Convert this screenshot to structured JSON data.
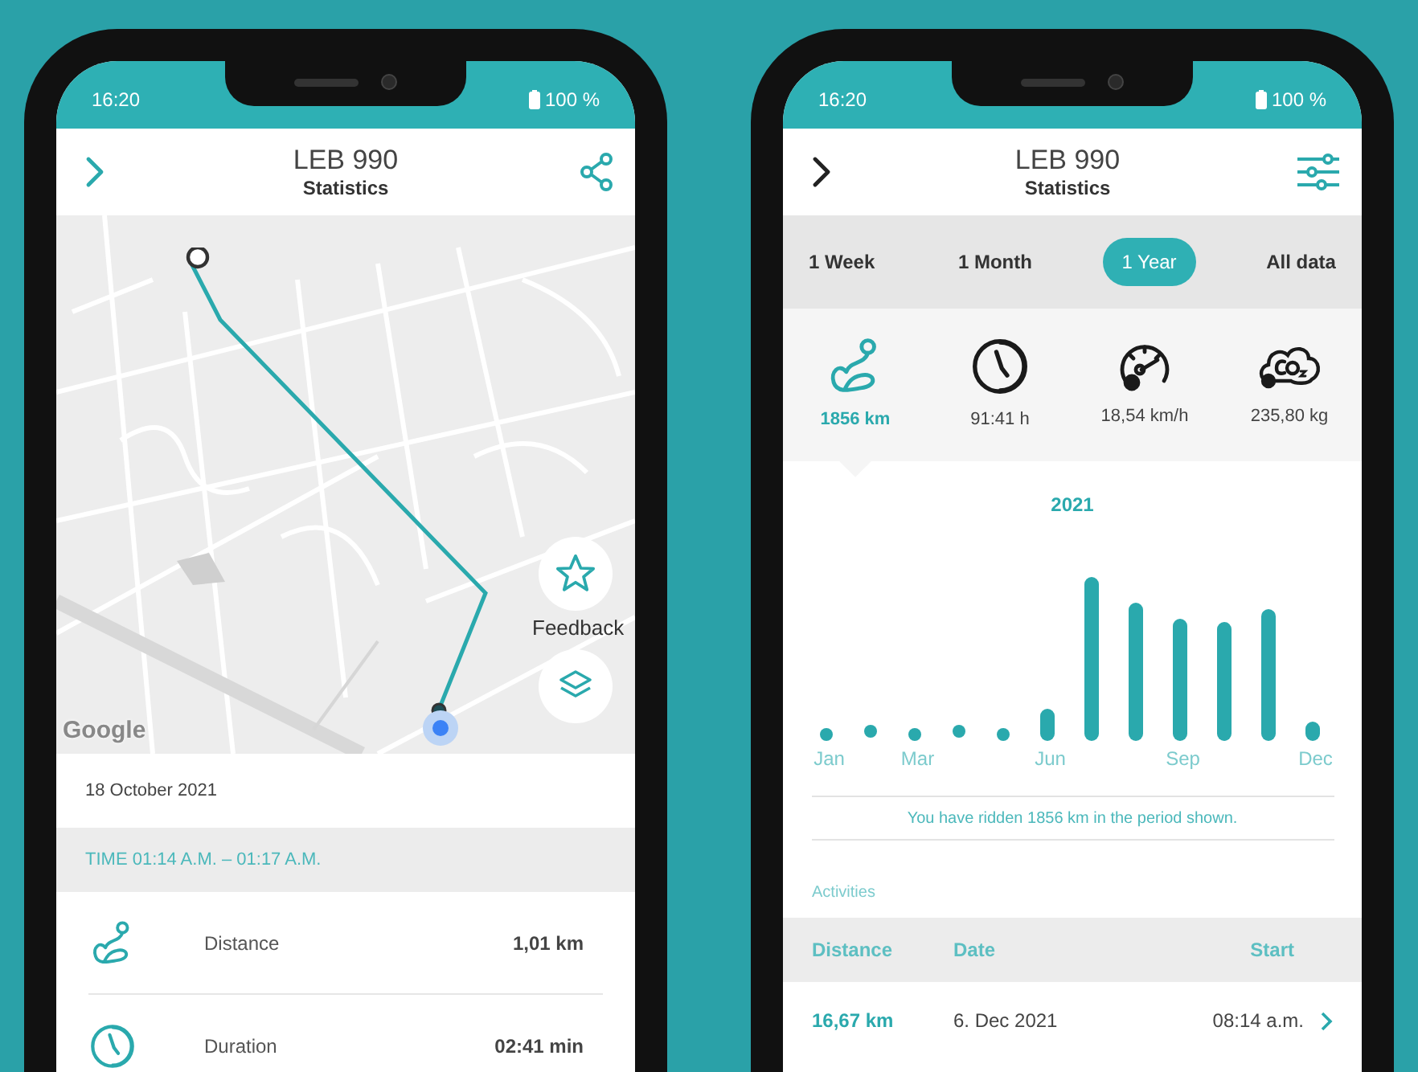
{
  "left_phone": {
    "status_bar": {
      "time": "16:20",
      "battery": "100 %"
    },
    "header": {
      "title": "LEB 990",
      "subtitle": "Statistics"
    },
    "map": {
      "attribution": "Google",
      "feedback_label": "Feedback"
    },
    "date": "18 October 2021",
    "time_range": "TIME 01:14 A.M. – 01:17 A.M.",
    "metrics": [
      {
        "kind": "distance",
        "label": "Distance",
        "value": "1,01 km"
      },
      {
        "kind": "duration",
        "label": "Duration",
        "value": "02:41 min"
      }
    ]
  },
  "right_phone": {
    "status_bar": {
      "time": "16:20",
      "battery": "100 %"
    },
    "header": {
      "title": "LEB 990",
      "subtitle": "Statistics"
    },
    "tabs": [
      {
        "label": "1 Week",
        "selected": false
      },
      {
        "label": "1 Month",
        "selected": false
      },
      {
        "label": "1 Year",
        "selected": true
      },
      {
        "label": "All data",
        "selected": false
      }
    ],
    "stats": [
      {
        "kind": "distance",
        "value": "1856 km",
        "selected": true
      },
      {
        "kind": "duration",
        "value": "91:41 h",
        "selected": false
      },
      {
        "kind": "speed",
        "value": "18,54 km/h",
        "selected": false
      },
      {
        "kind": "co2",
        "value": "235,80 kg",
        "selected": false
      }
    ],
    "chart": {
      "title": "2021",
      "month_labels": [
        "Jan",
        "Mar",
        "Jun",
        "Sep",
        "Dec"
      ]
    },
    "summary": "You have ridden 1856 km in the period shown.",
    "activities": {
      "title": "Activities",
      "columns": [
        "Distance",
        "Date",
        "Start"
      ],
      "rows": [
        {
          "distance": "16,67 km",
          "date": "6. Dec 2021",
          "start": "08:14 a.m."
        }
      ]
    }
  }
}
